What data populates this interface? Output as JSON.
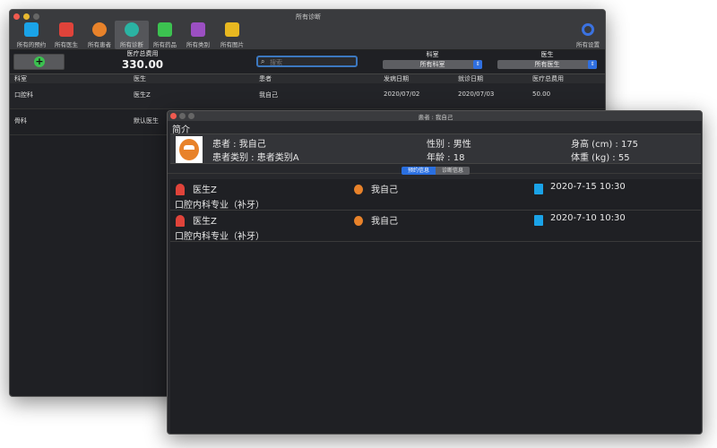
{
  "main": {
    "title": "所有诊断",
    "toolbar": [
      {
        "label": "所有的预约",
        "icon": "clipboard-clock-icon",
        "color": "#1aa3e8"
      },
      {
        "label": "所有医生",
        "icon": "doctor-icon",
        "color": "#e0433a"
      },
      {
        "label": "所有患者",
        "icon": "patient-icon",
        "color": "#e8822a"
      },
      {
        "label": "所有诊断",
        "icon": "stethoscope-icon",
        "color": "#2bb3a3"
      },
      {
        "label": "所有药品",
        "icon": "pill-icon",
        "color": "#3cc250"
      },
      {
        "label": "所有类别",
        "icon": "category-icon",
        "color": "#9b4fc2"
      },
      {
        "label": "所有图片",
        "icon": "image-icon",
        "color": "#e8b820"
      }
    ],
    "settings_label": "所有设置",
    "fee_label": "医疗总费用",
    "fee_value": "330.00",
    "search_placeholder": "搜索",
    "dept_label": "科室",
    "dept_value": "所有科室",
    "doctor_label": "医生",
    "doctor_value": "所有医生",
    "columns": [
      "科室",
      "医生",
      "患者",
      "发病日期",
      "就诊日期",
      "医疗总费用"
    ],
    "rows": [
      [
        "口腔科",
        "医生Z",
        "我自己",
        "2020/07/02",
        "2020/07/03",
        "50.00"
      ],
      [
        "骨科",
        "默认医生",
        "",
        "",
        "",
        ""
      ]
    ]
  },
  "detail": {
    "title": "患者 : 我自己",
    "section": "简介",
    "info": [
      "患者 : 我自己",
      "性别 : 男性",
      "身高 (cm) : 175",
      "患者类别 : 患者类别A",
      "年龄 : 18",
      "体重 (kg) : 55"
    ],
    "tabs": [
      "预约信息",
      "诊断信息"
    ],
    "active_tab": 0,
    "appointments": [
      {
        "doctor": "医生Z",
        "patient": "我自己",
        "datetime": "2020-7-15 10:30",
        "desc": "口腔内科专业（补牙）"
      },
      {
        "doctor": "医生Z",
        "patient": "我自己",
        "datetime": "2020-7-10 10:30",
        "desc": "口腔内科专业（补牙）"
      }
    ]
  }
}
